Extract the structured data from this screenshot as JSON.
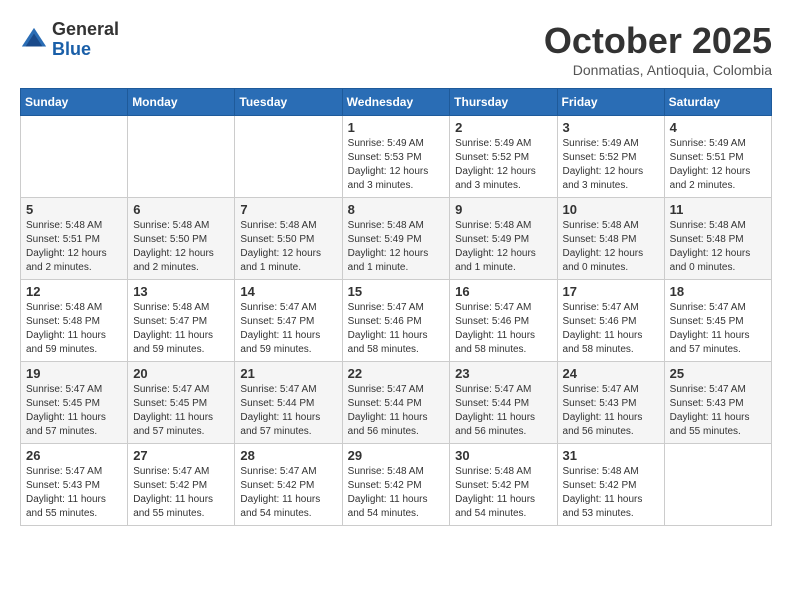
{
  "header": {
    "logo_general": "General",
    "logo_blue": "Blue",
    "month_title": "October 2025",
    "location": "Donmatias, Antioquia, Colombia"
  },
  "weekdays": [
    "Sunday",
    "Monday",
    "Tuesday",
    "Wednesday",
    "Thursday",
    "Friday",
    "Saturday"
  ],
  "weeks": [
    [
      {
        "day": "",
        "sunrise": "",
        "sunset": "",
        "daylight": ""
      },
      {
        "day": "",
        "sunrise": "",
        "sunset": "",
        "daylight": ""
      },
      {
        "day": "",
        "sunrise": "",
        "sunset": "",
        "daylight": ""
      },
      {
        "day": "1",
        "sunrise": "Sunrise: 5:49 AM",
        "sunset": "Sunset: 5:53 PM",
        "daylight": "Daylight: 12 hours and 3 minutes."
      },
      {
        "day": "2",
        "sunrise": "Sunrise: 5:49 AM",
        "sunset": "Sunset: 5:52 PM",
        "daylight": "Daylight: 12 hours and 3 minutes."
      },
      {
        "day": "3",
        "sunrise": "Sunrise: 5:49 AM",
        "sunset": "Sunset: 5:52 PM",
        "daylight": "Daylight: 12 hours and 3 minutes."
      },
      {
        "day": "4",
        "sunrise": "Sunrise: 5:49 AM",
        "sunset": "Sunset: 5:51 PM",
        "daylight": "Daylight: 12 hours and 2 minutes."
      }
    ],
    [
      {
        "day": "5",
        "sunrise": "Sunrise: 5:48 AM",
        "sunset": "Sunset: 5:51 PM",
        "daylight": "Daylight: 12 hours and 2 minutes."
      },
      {
        "day": "6",
        "sunrise": "Sunrise: 5:48 AM",
        "sunset": "Sunset: 5:50 PM",
        "daylight": "Daylight: 12 hours and 2 minutes."
      },
      {
        "day": "7",
        "sunrise": "Sunrise: 5:48 AM",
        "sunset": "Sunset: 5:50 PM",
        "daylight": "Daylight: 12 hours and 1 minute."
      },
      {
        "day": "8",
        "sunrise": "Sunrise: 5:48 AM",
        "sunset": "Sunset: 5:49 PM",
        "daylight": "Daylight: 12 hours and 1 minute."
      },
      {
        "day": "9",
        "sunrise": "Sunrise: 5:48 AM",
        "sunset": "Sunset: 5:49 PM",
        "daylight": "Daylight: 12 hours and 1 minute."
      },
      {
        "day": "10",
        "sunrise": "Sunrise: 5:48 AM",
        "sunset": "Sunset: 5:48 PM",
        "daylight": "Daylight: 12 hours and 0 minutes."
      },
      {
        "day": "11",
        "sunrise": "Sunrise: 5:48 AM",
        "sunset": "Sunset: 5:48 PM",
        "daylight": "Daylight: 12 hours and 0 minutes."
      }
    ],
    [
      {
        "day": "12",
        "sunrise": "Sunrise: 5:48 AM",
        "sunset": "Sunset: 5:48 PM",
        "daylight": "Daylight: 11 hours and 59 minutes."
      },
      {
        "day": "13",
        "sunrise": "Sunrise: 5:48 AM",
        "sunset": "Sunset: 5:47 PM",
        "daylight": "Daylight: 11 hours and 59 minutes."
      },
      {
        "day": "14",
        "sunrise": "Sunrise: 5:47 AM",
        "sunset": "Sunset: 5:47 PM",
        "daylight": "Daylight: 11 hours and 59 minutes."
      },
      {
        "day": "15",
        "sunrise": "Sunrise: 5:47 AM",
        "sunset": "Sunset: 5:46 PM",
        "daylight": "Daylight: 11 hours and 58 minutes."
      },
      {
        "day": "16",
        "sunrise": "Sunrise: 5:47 AM",
        "sunset": "Sunset: 5:46 PM",
        "daylight": "Daylight: 11 hours and 58 minutes."
      },
      {
        "day": "17",
        "sunrise": "Sunrise: 5:47 AM",
        "sunset": "Sunset: 5:46 PM",
        "daylight": "Daylight: 11 hours and 58 minutes."
      },
      {
        "day": "18",
        "sunrise": "Sunrise: 5:47 AM",
        "sunset": "Sunset: 5:45 PM",
        "daylight": "Daylight: 11 hours and 57 minutes."
      }
    ],
    [
      {
        "day": "19",
        "sunrise": "Sunrise: 5:47 AM",
        "sunset": "Sunset: 5:45 PM",
        "daylight": "Daylight: 11 hours and 57 minutes."
      },
      {
        "day": "20",
        "sunrise": "Sunrise: 5:47 AM",
        "sunset": "Sunset: 5:45 PM",
        "daylight": "Daylight: 11 hours and 57 minutes."
      },
      {
        "day": "21",
        "sunrise": "Sunrise: 5:47 AM",
        "sunset": "Sunset: 5:44 PM",
        "daylight": "Daylight: 11 hours and 57 minutes."
      },
      {
        "day": "22",
        "sunrise": "Sunrise: 5:47 AM",
        "sunset": "Sunset: 5:44 PM",
        "daylight": "Daylight: 11 hours and 56 minutes."
      },
      {
        "day": "23",
        "sunrise": "Sunrise: 5:47 AM",
        "sunset": "Sunset: 5:44 PM",
        "daylight": "Daylight: 11 hours and 56 minutes."
      },
      {
        "day": "24",
        "sunrise": "Sunrise: 5:47 AM",
        "sunset": "Sunset: 5:43 PM",
        "daylight": "Daylight: 11 hours and 56 minutes."
      },
      {
        "day": "25",
        "sunrise": "Sunrise: 5:47 AM",
        "sunset": "Sunset: 5:43 PM",
        "daylight": "Daylight: 11 hours and 55 minutes."
      }
    ],
    [
      {
        "day": "26",
        "sunrise": "Sunrise: 5:47 AM",
        "sunset": "Sunset: 5:43 PM",
        "daylight": "Daylight: 11 hours and 55 minutes."
      },
      {
        "day": "27",
        "sunrise": "Sunrise: 5:47 AM",
        "sunset": "Sunset: 5:42 PM",
        "daylight": "Daylight: 11 hours and 55 minutes."
      },
      {
        "day": "28",
        "sunrise": "Sunrise: 5:47 AM",
        "sunset": "Sunset: 5:42 PM",
        "daylight": "Daylight: 11 hours and 54 minutes."
      },
      {
        "day": "29",
        "sunrise": "Sunrise: 5:48 AM",
        "sunset": "Sunset: 5:42 PM",
        "daylight": "Daylight: 11 hours and 54 minutes."
      },
      {
        "day": "30",
        "sunrise": "Sunrise: 5:48 AM",
        "sunset": "Sunset: 5:42 PM",
        "daylight": "Daylight: 11 hours and 54 minutes."
      },
      {
        "day": "31",
        "sunrise": "Sunrise: 5:48 AM",
        "sunset": "Sunset: 5:42 PM",
        "daylight": "Daylight: 11 hours and 53 minutes."
      },
      {
        "day": "",
        "sunrise": "",
        "sunset": "",
        "daylight": ""
      }
    ]
  ]
}
